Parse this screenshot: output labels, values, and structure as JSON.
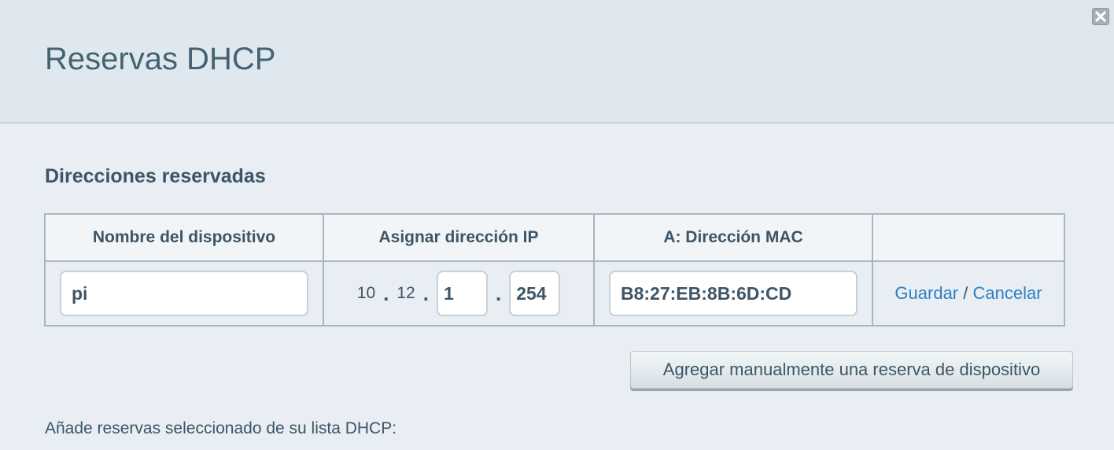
{
  "dialog": {
    "title": "Reservas DHCP",
    "close_icon": "close-icon"
  },
  "section": {
    "title": "Direcciones reservadas"
  },
  "table": {
    "headers": [
      "Nombre del dispositivo",
      "Asignar dirección IP",
      "A: Dirección MAC",
      ""
    ],
    "row": {
      "device_name": "pi",
      "ip": {
        "octet1": "10",
        "octet2": "12",
        "octet3": "1",
        "octet4": "254",
        "dot": "."
      },
      "mac": "B8:27:EB:8B:6D:CD",
      "save_label": "Guardar",
      "separator": "/",
      "cancel_label": "Cancelar"
    }
  },
  "add_button_label": "Agregar manualmente una reserva de dispositivo",
  "footer_text": "Añade reservas seleccionado de su lista DHCP:",
  "colors": {
    "link": "#2f7fc1",
    "text": "#3d5566",
    "header_bg": "#dfe8ef"
  }
}
